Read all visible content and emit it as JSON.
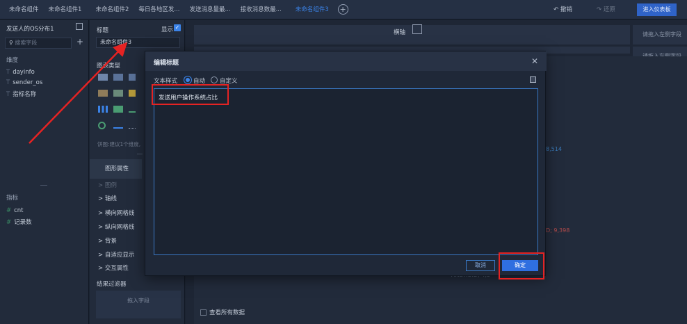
{
  "tabs": [
    {
      "label": "未命名组件"
    },
    {
      "label": "未命名组件1"
    },
    {
      "label": "未命名组件2"
    },
    {
      "label": "每日各地区发..."
    },
    {
      "label": "发送消息量最..."
    },
    {
      "label": "接收消息数最..."
    },
    {
      "label": "未命名组件3"
    }
  ],
  "toolbar": {
    "undo": "撤销",
    "redo": "还原",
    "enter_dashboard": "进入仪表板"
  },
  "left_panel": {
    "title": "发送人的OS分布1",
    "search_placeholder": "搜索字段",
    "dimension_section": "维度",
    "dimensions": [
      "dayinfo",
      "sender_os",
      "指标名称"
    ],
    "measure_section": "指标",
    "measures": [
      "cnt",
      "记录数"
    ]
  },
  "mid_panel": {
    "title_label": "标题",
    "show_label": "显示",
    "title_value": "未命名组件3",
    "chart_type_label": "图表类型",
    "pie_note": "饼图:建议1个维度,",
    "properties_header": "图形属性",
    "properties": [
      "图例",
      "轴线",
      "横向网格线",
      "纵向网格线",
      "背景",
      "自适应显示",
      "交互属性"
    ],
    "filter_title": "结果过滤器",
    "filter_placeholder": "拖入字段"
  },
  "canvas": {
    "horizontal_axis_label": "横轴",
    "drop_left_field": "请拖入左侧字段",
    "value_1": "8,514",
    "value_2": "D; 9,398",
    "value_3": "ANDROID; 4,3",
    "view_all_data": "查看所有数据"
  },
  "modal": {
    "title": "编辑标题",
    "style_label": "文本样式",
    "option_auto": "自动",
    "option_custom": "自定义",
    "editor_text": "发送用户操作系统占比",
    "cancel": "取消",
    "confirm": "确定"
  },
  "colors": {
    "accent": "#3b83e8",
    "highlight": "#e52323",
    "background": "#1b2331"
  }
}
